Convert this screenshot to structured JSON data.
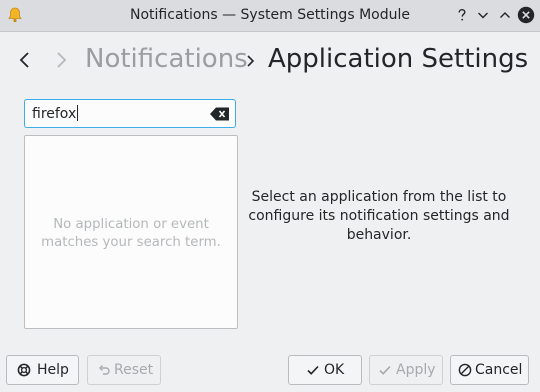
{
  "window": {
    "title": "Notifications — System Settings Module",
    "icon": "bell-icon",
    "controls": [
      "help",
      "minimize",
      "maximize",
      "close"
    ]
  },
  "breadcrumb": {
    "parent": "Notifications",
    "current": "Application Settings"
  },
  "search": {
    "value": "firefox",
    "placeholder": ""
  },
  "app_list": {
    "empty_line1": "No application or event",
    "empty_line2": "matches your search term."
  },
  "detail": {
    "line1": "Select an application from the list to",
    "line2": "configure its notification settings and",
    "line3": "behavior."
  },
  "buttons": {
    "help": "Help",
    "reset": "Reset",
    "ok": "OK",
    "apply": "Apply",
    "cancel": "Cancel"
  },
  "colors": {
    "accent": "#3daee9",
    "window_bg": "#eff0f1",
    "titlebar_bg": "#dadcdf",
    "disabled_text": "#a7aaad"
  }
}
